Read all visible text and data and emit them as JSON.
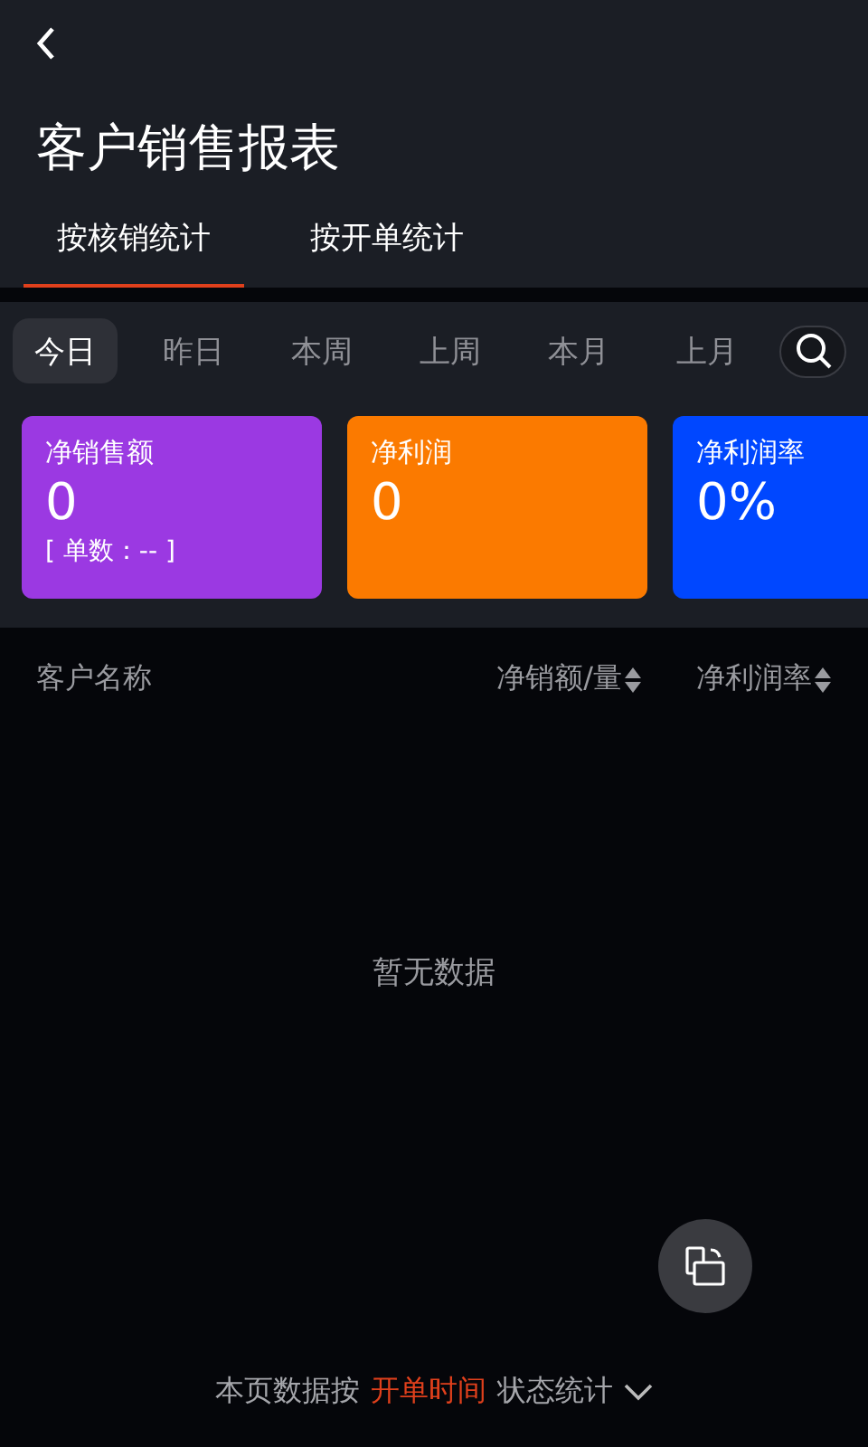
{
  "title": "客户销售报表",
  "tabs": [
    {
      "label": "按核销统计",
      "selected": true
    },
    {
      "label": "按开单统计",
      "selected": false
    }
  ],
  "periods": [
    {
      "label": "今日",
      "selected": true
    },
    {
      "label": "昨日",
      "selected": false
    },
    {
      "label": "本周",
      "selected": false
    },
    {
      "label": "上周",
      "selected": false
    },
    {
      "label": "本月",
      "selected": false
    },
    {
      "label": "上月",
      "selected": false
    }
  ],
  "cards": [
    {
      "label": "净销售额",
      "value": "0",
      "note": "[ 单数：-- ]",
      "color": "#9b39e2"
    },
    {
      "label": "净利润",
      "value": "0",
      "color": "#fb7a00"
    },
    {
      "label": "净利润率",
      "value": "0%",
      "color": "#0047ff"
    }
  ],
  "table": {
    "columns": [
      {
        "label": "客户名称",
        "sortable": false
      },
      {
        "label": "净销额/量",
        "sortable": true
      },
      {
        "label": "净利润率",
        "sortable": true
      }
    ],
    "empty": "暂无数据"
  },
  "footer": {
    "prefix": "本页数据按",
    "highlight": "开单时间",
    "suffix": "状态统计"
  }
}
